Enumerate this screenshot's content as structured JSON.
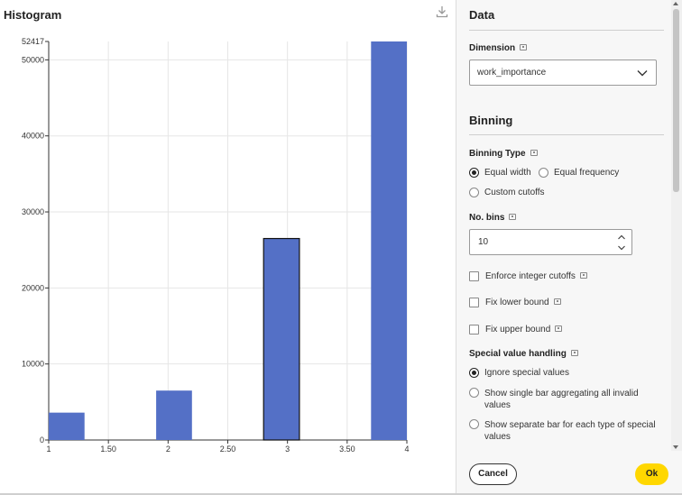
{
  "chart_panel": {
    "title": "Histogram",
    "download_icon": "download-icon"
  },
  "chart_data": {
    "type": "bar",
    "title": "Histogram",
    "xlabel": "",
    "ylabel": "",
    "x_ticks": [
      "1",
      "1.50",
      "2",
      "2.50",
      "3",
      "3.50",
      "4"
    ],
    "x_tick_values": [
      1,
      1.5,
      2,
      2.5,
      3,
      3.5,
      4
    ],
    "xlim": [
      1,
      4
    ],
    "y_ticks": [
      "0",
      "10000",
      "20000",
      "30000",
      "40000",
      "50000",
      "52417"
    ],
    "y_tick_values": [
      0,
      10000,
      20000,
      30000,
      40000,
      50000,
      52417
    ],
    "ylim": [
      0,
      52417
    ],
    "bins": [
      {
        "x0": 1.0,
        "x1": 1.3,
        "value": 3600
      },
      {
        "x0": 1.9,
        "x1": 2.2,
        "value": 6500
      },
      {
        "x0": 2.8,
        "x1": 3.1,
        "value": 26500,
        "highlighted": true
      },
      {
        "x0": 3.7,
        "x1": 4.0,
        "value": 52417
      }
    ],
    "bar_color": "#5470c6",
    "grid": true
  },
  "settings": {
    "data_section_title": "Data",
    "dimension_label": "Dimension",
    "dimension_value": "work_importance",
    "binning_section_title": "Binning",
    "binning_type_label": "Binning Type",
    "binning_type_options": [
      {
        "label": "Equal width",
        "checked": true
      },
      {
        "label": "Equal frequency",
        "checked": false
      },
      {
        "label": "Custom cutoffs",
        "checked": false
      }
    ],
    "no_bins_label": "No. bins",
    "no_bins_value": "10",
    "enforce_integer_label": "Enforce integer cutoffs",
    "fix_lower_label": "Fix lower bound",
    "fix_upper_label": "Fix upper bound",
    "special_value_label": "Special value handling",
    "special_value_options": [
      {
        "label": "Ignore special values",
        "checked": true
      },
      {
        "label": "Show single bar aggregating all invalid values",
        "checked": false
      },
      {
        "label": "Show separate bar for each type of special values",
        "checked": false
      }
    ]
  },
  "footer": {
    "cancel_label": "Cancel",
    "ok_label": "Ok"
  },
  "colors": {
    "accent": "#ffd700",
    "bar": "#5470c6"
  }
}
